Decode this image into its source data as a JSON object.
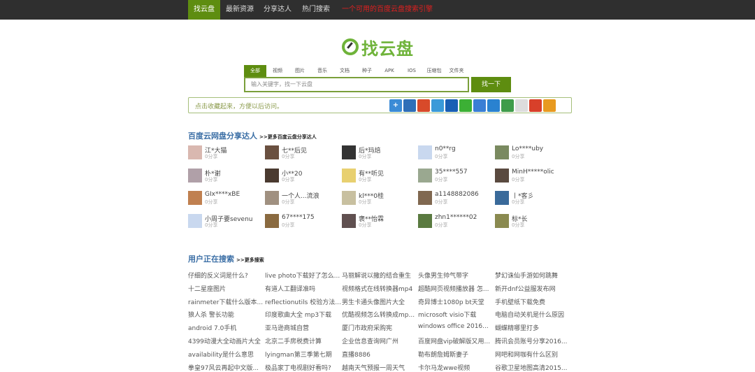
{
  "nav": {
    "items": [
      "找云盘",
      "最新资源",
      "分享达人",
      "热门搜索"
    ],
    "slogan": "一个可用的百度云盘搜索引擎"
  },
  "logo": {
    "text": "找云盘"
  },
  "tabs": [
    "全部",
    "视频",
    "图片",
    "音乐",
    "文档",
    "种子",
    "APK",
    "IOS",
    "压缩包",
    "文件夹"
  ],
  "search": {
    "placeholder": "输入关键字，找一下云盘",
    "button": "找一下"
  },
  "bookmark": {
    "text": "点击收藏起来，方便以后访问。",
    "icons": [
      "plus-icon",
      "qzone-icon",
      "weibo-icon",
      "tqq-icon",
      "renren-icon",
      "wechat-icon",
      "baidu-icon",
      "qq-icon",
      "douban-icon",
      "copy-icon",
      "xiaoyou-icon",
      "kaixin-icon"
    ],
    "colors": [
      "#3b8bd6",
      "#2f6fb8",
      "#d84a2a",
      "#3a9ad9",
      "#1a5fb4",
      "#3cb035",
      "#3a7fd5",
      "#2a82d0",
      "#3f9c4a",
      "#dddddd",
      "#d8402a",
      "#e89a20"
    ]
  },
  "sharers": {
    "title": "百度云网盘分享达人",
    "more": ">>更多百度云盘分享达人",
    "users": [
      {
        "name": "江*大猫",
        "count": "0分享",
        "color": "#d9b8b0"
      },
      {
        "name": "七**后见",
        "count": "0分享",
        "color": "#6a5040"
      },
      {
        "name": "后*玛焙",
        "count": "0分享",
        "color": "#333"
      },
      {
        "name": "n0**rg",
        "count": "0分享",
        "color": "#c9d8ef"
      },
      {
        "name": "Lo****uby",
        "count": "0分享",
        "color": "#7a8a60"
      },
      {
        "name": "朴*谢",
        "count": "0分享",
        "color": "#b0a0a8"
      },
      {
        "name": "小**20",
        "count": "0分享",
        "color": "#4a3a30"
      },
      {
        "name": "有**听见",
        "count": "0分享",
        "color": "#e8d070"
      },
      {
        "name": "35****557",
        "count": "0分享",
        "color": "#9aa890"
      },
      {
        "name": "MinH*****olic",
        "count": "0分享",
        "color": "#5a4a40"
      },
      {
        "name": "GIx****xBE",
        "count": "0分享",
        "color": "#c08050"
      },
      {
        "name": "一个人...流浪",
        "count": "0分享",
        "color": "#a09080"
      },
      {
        "name": "kl***0桂",
        "count": "0分享",
        "color": "#c8c0a0"
      },
      {
        "name": "a1148882086",
        "count": "0分享",
        "color": "#806850"
      },
      {
        "name": "丨*客彡",
        "count": "0分享",
        "color": "#3a6a9a"
      },
      {
        "name": "小周子要sevenu",
        "count": "0分享",
        "color": "#c9d8ef"
      },
      {
        "name": "67****175",
        "count": "0分享",
        "color": "#8a6a40"
      },
      {
        "name": "褒**怡霖",
        "count": "0分享",
        "color": "#605050"
      },
      {
        "name": "zhn1******02",
        "count": "0分享",
        "color": "#5a7a40"
      },
      {
        "name": "标*长",
        "count": "0分享",
        "color": "#8a8a50"
      }
    ]
  },
  "searching": {
    "title": "用户正在搜索",
    "more": ">>更多搜索",
    "queries": [
      "仔细的反义词是什么?",
      "live photo下载好了怎么...",
      "马丽解说以撒的结合重生",
      "头像男生帅气带字",
      "梦幻诛仙手游如何跳舞",
      "十二星座图片",
      "有道人工翻译准吗",
      "视频格式在线转换器mp4",
      "超酷网页视频播放器 怎...",
      "新开dnf公益服发布网",
      "rainmeter下载什么版本...",
      "reflectionutils 校验方法...",
      "男生卡通头像图片大全",
      "奇异博士1080p bt天堂",
      "手机壁纸下载免费",
      "狼人杀 警长功能",
      "印度歌曲大全 mp3下载",
      "优酷视频怎么转换成mp...",
      "microsoft visio下载",
      "电脑自动关机是什么原因",
      "android 7.0手机",
      "亚马逊商城自营",
      "厦门市政府采购宪",
      "windows office 2016...",
      "蝴蝶精哪里打多",
      "4399动漫大全动画片大全",
      "北京二手房税费计算",
      "企业信息查询网广州",
      "百度网盘vip破解版又用...",
      "腾讯会员账号分享2016...",
      "availability是什么意思",
      "lyingman第三季第七期",
      "直播8886",
      "勒布朗詹姆斯妻子",
      "网吧和网咖有什么区别",
      "拳皇97风云再起中文版...",
      "极品家丁电视剧好看吗?",
      "越南天气预报一周天气",
      "卡尔马龙wwe视频",
      "谷歌卫星地图高清2015..."
    ]
  }
}
